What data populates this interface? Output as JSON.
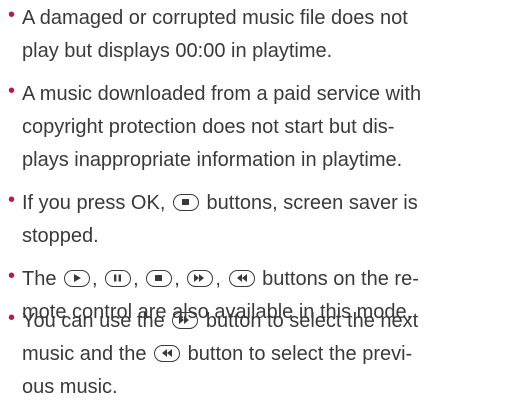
{
  "notes": [
    {
      "lines": [
        "A damaged or corrupted music file does not",
        "play but displays 00:00 in playtime."
      ]
    },
    {
      "lines": [
        "A music downloaded from a paid service with",
        "copyright protection does not start but dis-",
        "plays inappropriate information in playtime."
      ]
    },
    {
      "line1_a": "If you press OK,",
      "line1_b": "buttons, screen saver is",
      "line2": "stopped."
    },
    {
      "line1_a": "The",
      "sep": ",",
      "line1_b": "buttons on the re-",
      "line2": "mote control are also available in this mode."
    },
    {
      "line1_a": "You can use the",
      "line1_b": "button to select the next",
      "line2_a": "music and the",
      "line2_b": "button to select the previ-",
      "line3": "ous music."
    }
  ],
  "icons": {
    "play": "play-button-icon",
    "pause": "pause-button-icon",
    "stop": "stop-button-icon",
    "forward": "fast-forward-button-icon",
    "rewind": "rewind-button-icon"
  },
  "colors": {
    "bullet": "#c0134f",
    "text": "#3a3a3a"
  }
}
